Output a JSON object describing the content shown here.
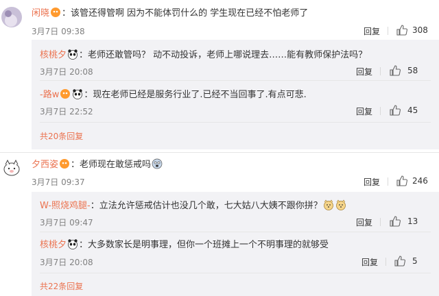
{
  "comments": [
    {
      "user": "闲晓",
      "text": "：该管还得管啊 因为不能体罚什么的 学生现在已经不怕老师了",
      "time": "3月7日 09:38",
      "reply_label": "回复",
      "likes": "308",
      "replies": [
        {
          "user": "核桃夕",
          "text": "：老师还敢管吗？ 动不动投诉，老师上哪说理去……能有教师保护法吗？",
          "time": "3月7日 20:08",
          "reply_label": "回复",
          "likes": "58"
        },
        {
          "user": "-路w",
          "text": "：现在老师已经是服务行业了.已经不当回事了.有点可悲.",
          "time": "3月7日 22:52",
          "reply_label": "回复",
          "likes": "45"
        }
      ],
      "more": "共20条回复"
    },
    {
      "user": "夕西姿",
      "text": "：老师现在敢惩戒吗",
      "time": "3月7日 09:37",
      "reply_label": "回复",
      "likes": "246",
      "replies": [
        {
          "user": "W-照烧鸡腿-",
          "text": "：立法允许惩戒估计也没几个敢，七大姑八大姨不跟你拼？",
          "time": "3月7日 09:47",
          "reply_label": "回复",
          "likes": "13"
        },
        {
          "user": "核桃夕",
          "text": "：大多数家长是明事理，但你一个班摊上一个不明事理的就够受",
          "time": "3月7日 20:08",
          "reply_label": "回复",
          "likes": "5"
        }
      ],
      "more": "共22条回复"
    }
  ],
  "icons": {
    "like": "thumb-up-icon",
    "vip": "vip-badge-icon",
    "panda": "panda-emoji-icon"
  },
  "colors": {
    "name": "#eb7350",
    "meta": "#808080",
    "reply_bg": "#f2f2f5"
  }
}
